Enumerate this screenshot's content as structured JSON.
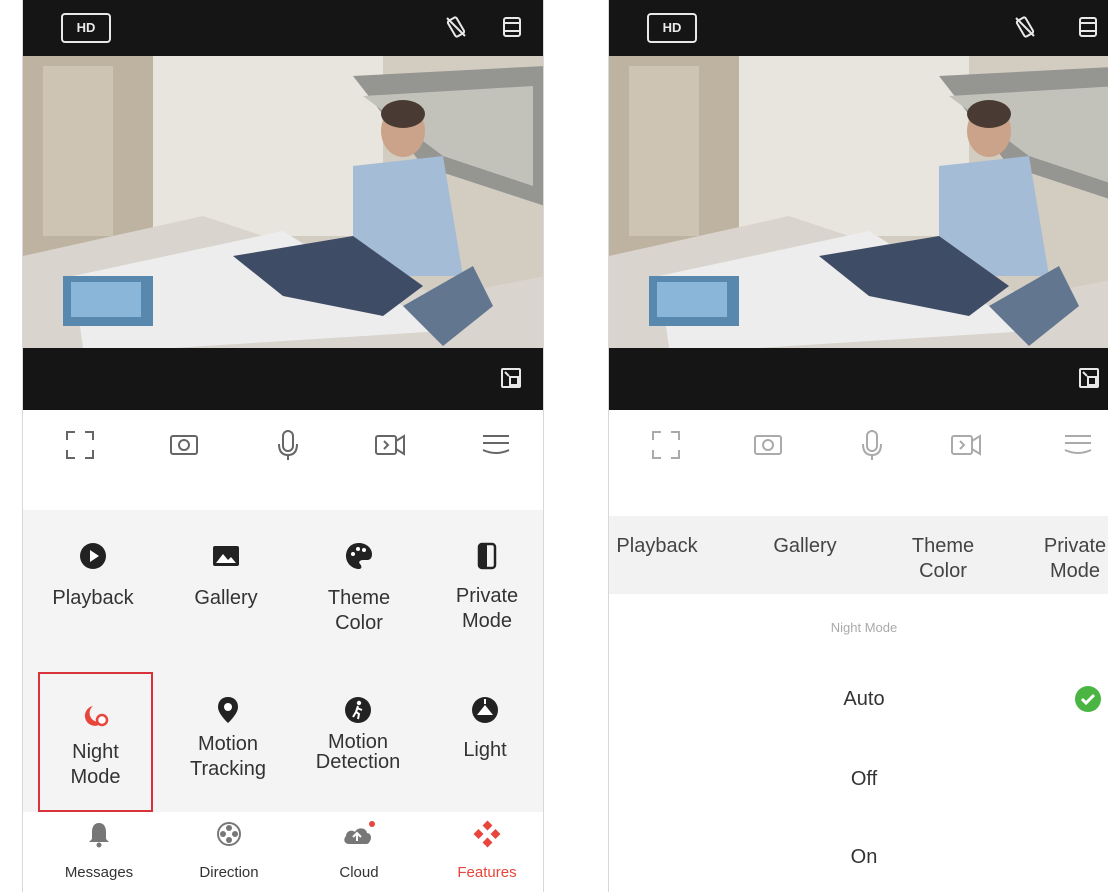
{
  "phone1": {
    "topbar": {
      "hd_label": "HD"
    },
    "grid_items": [
      {
        "label": "Playback",
        "icon": "playback-icon"
      },
      {
        "label": "Gallery",
        "icon": "gallery-icon"
      },
      {
        "label": "Theme\nColor",
        "icon": "palette-icon"
      },
      {
        "label": "Private\nMode",
        "icon": "private-mode-icon"
      },
      {
        "label": "Night\nMode",
        "icon": "night-mode-icon",
        "selected": true
      },
      {
        "label": "Motion\nTracking",
        "icon": "location-pin-icon"
      },
      {
        "label": "Motion\nDetection",
        "icon": "walking-person-icon"
      },
      {
        "label": "Light",
        "icon": "light-icon"
      }
    ],
    "bottom_nav": [
      {
        "label": "Messages",
        "icon": "bell-icon"
      },
      {
        "label": "Direction",
        "icon": "direction-pad-icon"
      },
      {
        "label": "Cloud",
        "icon": "cloud-upload-icon",
        "badge_dot": true
      },
      {
        "label": "Features",
        "icon": "features-icon",
        "active": true
      }
    ]
  },
  "phone2": {
    "topbar": {
      "hd_label": "HD"
    },
    "tabs": [
      "Playback",
      "Gallery",
      "Theme\nColor",
      "Private\nMode"
    ],
    "night_mode": {
      "title": "Night Mode",
      "options": [
        "Auto",
        "Off",
        "On"
      ],
      "selected": "Auto"
    }
  },
  "colors": {
    "accent_red": "#e8453c",
    "selection_border": "#d8333a",
    "check_green": "#4bb543",
    "bar_dark": "#151515"
  }
}
